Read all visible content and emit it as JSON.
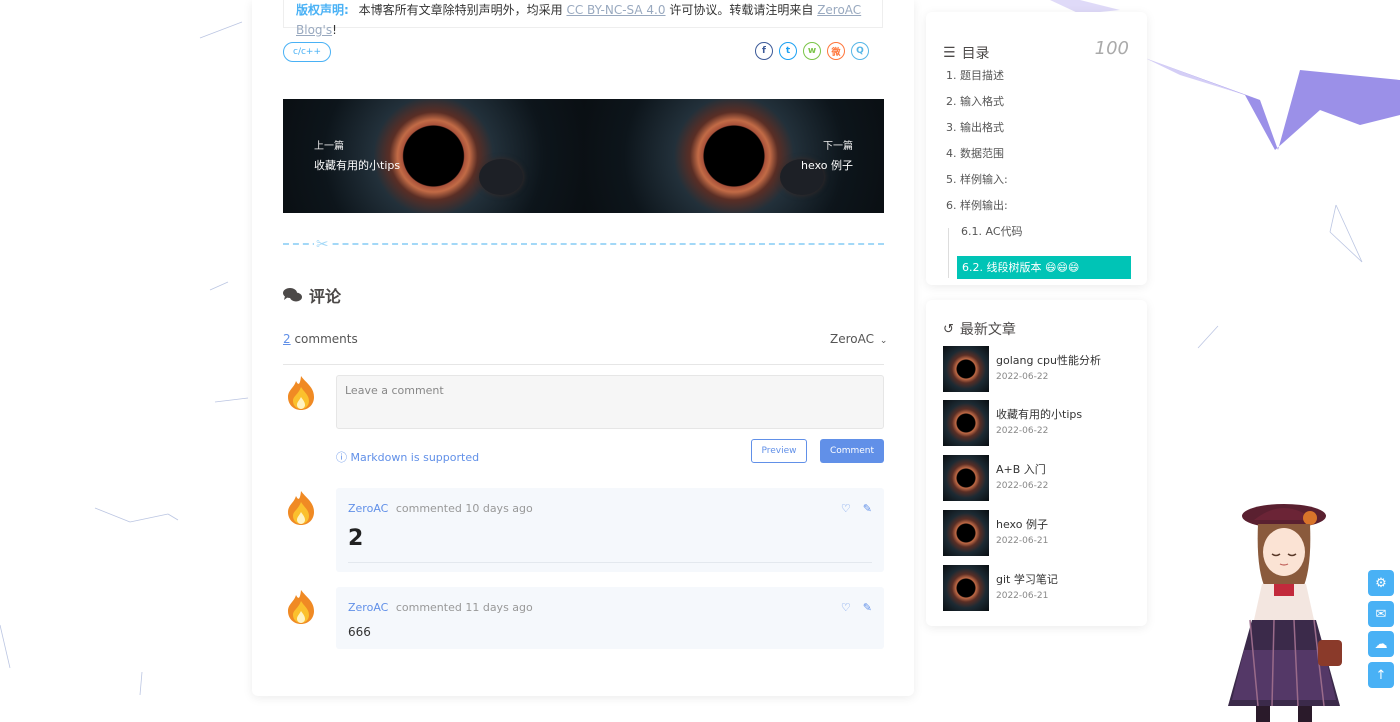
{
  "copyright": {
    "label": "版权声明:",
    "text_before": "本博客所有文章除特别声明外，均采用",
    "license": "CC BY-NC-SA 4.0",
    "text_middle": "许可协议。转载请注明来自",
    "blog": "ZeroAC Blog's",
    "text_end": "!"
  },
  "tag": "c/c++",
  "share": [
    {
      "icon": "facebook-icon",
      "glyph": "f",
      "color": "#3b5998"
    },
    {
      "icon": "twitter-icon",
      "glyph": "t",
      "color": "#1da1f2"
    },
    {
      "icon": "wechat-icon",
      "glyph": "w",
      "color": "#7bc549"
    },
    {
      "icon": "weibo-icon",
      "glyph": "微",
      "color": "#ff763b"
    },
    {
      "icon": "qq-icon",
      "glyph": "Q",
      "color": "#56b6e7"
    }
  ],
  "post_nav": {
    "prev_label": "上一篇",
    "prev_title": "收藏有用的小tips",
    "next_label": "下一篇",
    "next_title": "hexo 例子"
  },
  "comments": {
    "heading": "评论",
    "count": "2",
    "count_suffix": " comments",
    "user": "ZeroAC",
    "placeholder": "Leave a comment",
    "markdown_note": "Markdown is supported",
    "preview_label": "Preview",
    "comment_label": "Comment",
    "items": [
      {
        "author": "ZeroAC",
        "verb": "commented",
        "time": "10 days ago",
        "body": "2"
      },
      {
        "author": "ZeroAC",
        "verb": "commented",
        "time": "11 days ago",
        "body": "666"
      }
    ]
  },
  "toc": {
    "title": "目录",
    "percent": "100",
    "items": [
      "1. 题目描述",
      "2. 输入格式",
      "3. 输出格式",
      "4. 数据范围",
      "5. 样例输入:",
      "6. 样例输出:",
      "6.1. AC代码",
      "6.2. 线段树版本 😄😄😄"
    ]
  },
  "recent": {
    "title": "最新文章",
    "items": [
      {
        "title": "golang cpu性能分析",
        "date": "2022-06-22"
      },
      {
        "title": "收藏有用的小tips",
        "date": "2022-06-22"
      },
      {
        "title": "A+B 入门",
        "date": "2022-06-22"
      },
      {
        "title": "hexo 例子",
        "date": "2022-06-21"
      },
      {
        "title": "git 学习笔记",
        "date": "2022-06-21"
      }
    ]
  },
  "float_buttons": [
    "gear-icon",
    "comment-icon",
    "chat-icon",
    "arrow-up-icon"
  ],
  "colors": {
    "accent": "#49b1f5",
    "comment_blue": "#6190e8",
    "toc_active": "#00c4b6"
  }
}
